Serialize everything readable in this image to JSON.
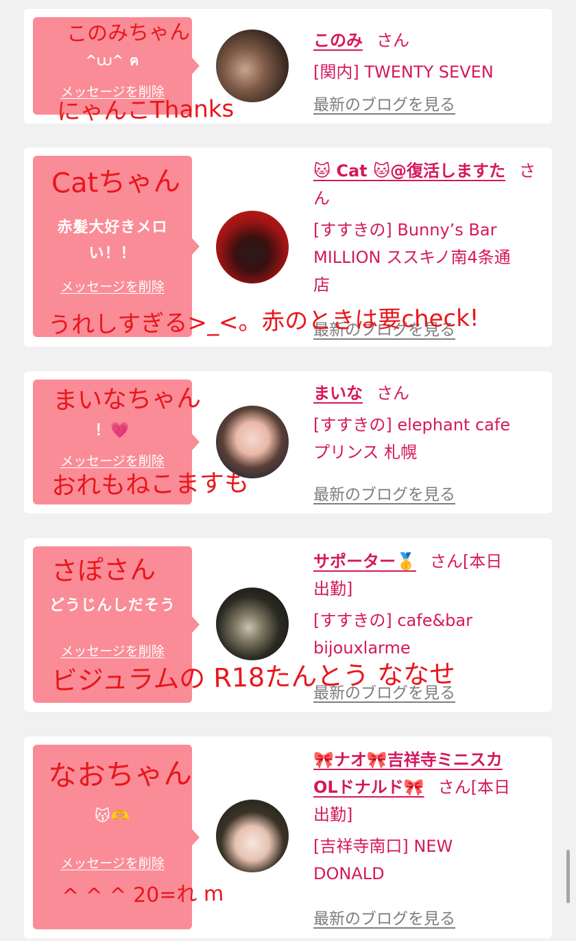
{
  "cards": [
    {
      "bubble_text": "",
      "bubble_emoji": "^⩊^ ฅ",
      "delete_label": "メッセージを削除",
      "name": "このみ",
      "san": "さん",
      "shop": "[関内] TWENTY SEVEN",
      "blog": "最新のブログを見る",
      "hand_title": "このみちゃん",
      "hand_note": "にゃんこThanks"
    },
    {
      "bubble_text": "赤髪大好きメロい！！",
      "delete_label": "メッセージを削除",
      "name_line1": "🐱 Cat 🐱@復活しますた",
      "san": "さん",
      "shop_line1": "[すすきの] Bunny’s Bar",
      "shop_line2": "MILLION ススキノ南4条通",
      "shop_line3": "店",
      "blog": "最新のブログを見る",
      "hand_title": "Catちゃん",
      "hand_note": "うれしすぎる>_<。赤のときは要check!"
    },
    {
      "bubble_text": "！💗",
      "delete_label": "メッセージを削除",
      "name": "まいな",
      "san": "さん",
      "shop_line1": "[すすきの] elephant cafe",
      "shop_line2": "プリンス 札幌",
      "blog": "最新のブログを見る",
      "hand_title": "まいなちゃん",
      "hand_note": "おれもねこますも"
    },
    {
      "bubble_text": "どうじんしだそう",
      "delete_label": "メッセージを削除",
      "name": "サポーター🥇",
      "san": "さん[本日",
      "san_line2": "出勤]",
      "shop_line1": "[すすきの] cafe&bar",
      "shop_line2": "bijouxlarme",
      "blog": "最新のブログを見る",
      "hand_title": "さぽさん",
      "hand_note": "ビジュラムの R18たんとう ななせ"
    },
    {
      "bubble_text": "😽🫶",
      "delete_label": "メッセージを削除",
      "name_line1": "🎀ナオ🎀吉祥寺ミニスカ",
      "name_line2": "OLドナルド🎀",
      "san": "さん[本日",
      "san_line2": "出勤]",
      "shop_line1": "[吉祥寺南口] NEW",
      "shop_line2": "DONALD",
      "blog": "最新のブログを見る",
      "hand_title": "なおちゃん",
      "hand_note": "^ ^ ^ 20=れ m"
    }
  ],
  "colors": {
    "bubble": "#fa8c97",
    "accent": "#d5175c",
    "ink": "#e8161c"
  }
}
